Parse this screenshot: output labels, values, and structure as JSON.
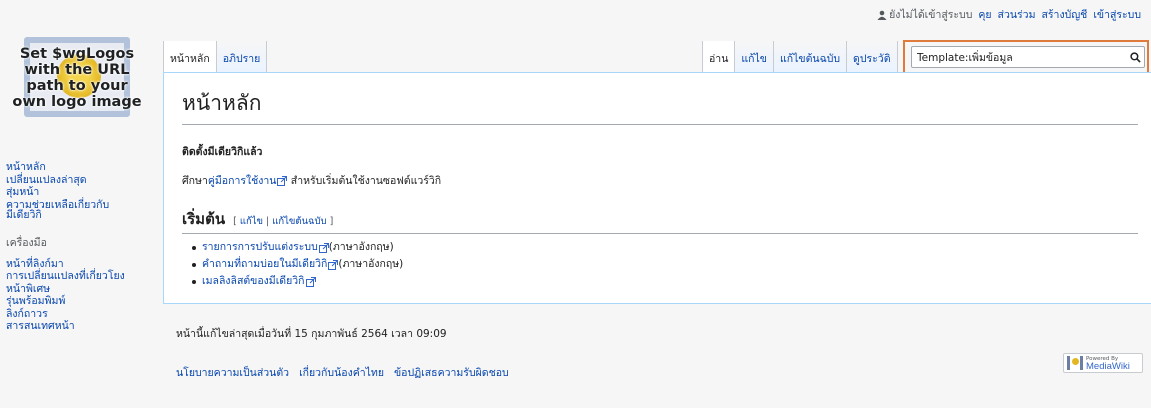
{
  "personal": {
    "not_logged_in": "ยังไม่ได้เข้าสู่ระบบ",
    "talk": "คุย",
    "contributions": "ส่วนร่วม",
    "create_account": "สร้างบัญชี",
    "login": "เข้าสู่ระบบ"
  },
  "logo": {
    "text": "Set $wgLogos with the URL path to your own logo image"
  },
  "sidebar": {
    "navigation": [
      {
        "label": "หน้าหลัก"
      },
      {
        "label": "เปลี่ยนแปลงล่าสุด"
      },
      {
        "label": "สุ่มหน้า"
      },
      {
        "label": "ความช่วยเหลือเกี่ยวกับมีเดียวิกิ"
      }
    ],
    "tools_heading": "เครื่องมือ",
    "tools": [
      {
        "label": "หน้าที่ลิงก์มา"
      },
      {
        "label": "การเปลี่ยนแปลงที่เกี่ยวโยง"
      },
      {
        "label": "หน้าพิเศษ"
      },
      {
        "label": "รุ่นพร้อมพิมพ์"
      },
      {
        "label": "ลิงก์ถาวร"
      },
      {
        "label": "สารสนเทศหน้า"
      }
    ]
  },
  "tabs": {
    "left": [
      {
        "label": "หน้าหลัก",
        "selected": true
      },
      {
        "label": "อภิปราย",
        "selected": false
      }
    ],
    "right": [
      {
        "label": "อ่าน",
        "selected": true
      },
      {
        "label": "แก้ไข",
        "selected": false
      },
      {
        "label": "แก้ไขต้นฉบับ",
        "selected": false
      },
      {
        "label": "ดูประวัติ",
        "selected": false
      }
    ]
  },
  "search": {
    "value": "Template:เพิ่มข้อมูล",
    "highlight_color": "#e07b3e"
  },
  "content": {
    "title": "หน้าหลัก",
    "installed": "ติดตั้งมีเดียวิกิแล้ว",
    "consult_prefix": "ศึกษา",
    "consult_link": "คู่มือการใช้งาน",
    "consult_suffix": " สำหรับเริ่มต้นใช้งานซอฟต์แวร์วิกิ",
    "getting_started": "เริ่มต้น",
    "edit_open": "[",
    "edit_link": "แก้ไข",
    "edit_sep": "|",
    "edit_source_link": "แก้ไขต้นฉบับ",
    "edit_close": "]",
    "links": [
      {
        "link": "รายการการปรับแต่งระบบ",
        "suffix": " (ภาษาอังกฤษ)"
      },
      {
        "link": "คำถามที่ถามบ่อยในมีเดียวิกิ",
        "suffix": " (ภาษาอังกฤษ)"
      },
      {
        "link": "เมลลิงลิสต์ของมีเดียวิกิ",
        "suffix": ""
      }
    ]
  },
  "footer": {
    "lastmod": "หน้านี้แก้ไขล่าสุดเมื่อวันที่ 15 กุมภาพันธ์ 2564 เวลา 09:09",
    "privacy": "นโยบายความเป็นส่วนตัว",
    "about": "เกี่ยวกับน้องคำไทย",
    "disclaimer": "ข้อปฏิเสธความรับผิดชอบ",
    "powered_small": "Powered By",
    "powered_big": "MediaWiki"
  }
}
